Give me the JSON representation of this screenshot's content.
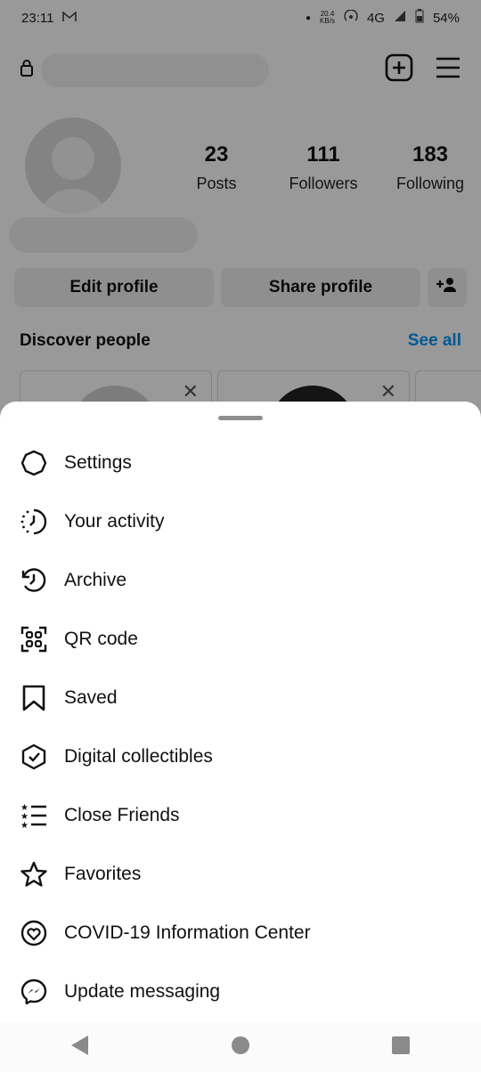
{
  "status_bar": {
    "time": "23:11",
    "mail_icon": "gmail-icon",
    "data_rate_value": "20.4",
    "data_rate_unit": "KB/s",
    "network": "4G",
    "battery": "54%"
  },
  "header": {
    "username": "",
    "lock_icon": "lock-icon",
    "add_icon": "plus-square-icon",
    "menu_icon": "hamburger-icon"
  },
  "profile": {
    "stats": [
      {
        "value": "23",
        "label": "Posts"
      },
      {
        "value": "111",
        "label": "Followers"
      },
      {
        "value": "183",
        "label": "Following"
      }
    ],
    "edit_label": "Edit profile",
    "share_label": "Share profile"
  },
  "discover": {
    "title": "Discover people",
    "see_all": "See all"
  },
  "menu": {
    "items": [
      {
        "label": "Settings",
        "icon": "settings-icon"
      },
      {
        "label": "Your activity",
        "icon": "activity-icon"
      },
      {
        "label": "Archive",
        "icon": "archive-icon"
      },
      {
        "label": "QR code",
        "icon": "qr-code-icon"
      },
      {
        "label": "Saved",
        "icon": "bookmark-icon"
      },
      {
        "label": "Digital collectibles",
        "icon": "collectibles-icon"
      },
      {
        "label": "Close Friends",
        "icon": "close-friends-icon"
      },
      {
        "label": "Favorites",
        "icon": "star-icon"
      },
      {
        "label": "COVID-19 Information Center",
        "icon": "covid-heart-icon"
      },
      {
        "label": "Update messaging",
        "icon": "messenger-icon"
      }
    ]
  },
  "colors": {
    "accent": "#0095f6",
    "scrim": "rgba(0,0,0,0.4)",
    "text": "#111111"
  }
}
